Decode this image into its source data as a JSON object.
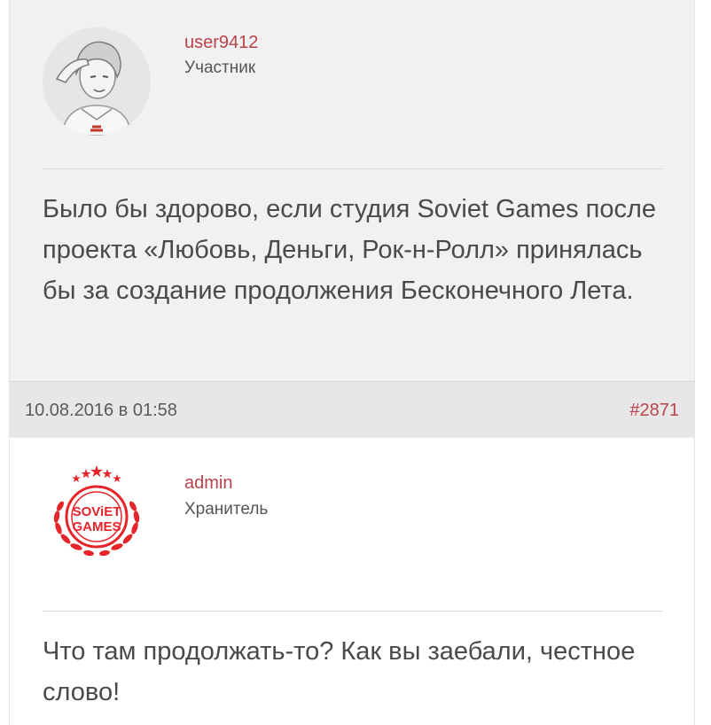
{
  "posts": [
    {
      "username": "user9412",
      "role": "Участник",
      "avatar_icon": "user-avatar-photo",
      "text": "Было бы здорово, если студия Soviet Games после проекта «Любовь, Деньги, Рок-н-Ролл» принялась бы за создание продолжения Бесконечного Лета.",
      "date": "10.08.2016 в 01:58",
      "number": "#2871"
    },
    {
      "username": "admin",
      "role": "Хранитель",
      "avatar_icon": "soviet-games-logo",
      "avatar_logo_text": [
        "SOViET",
        "GAMES"
      ],
      "text": "Что там продолжать-то? Как вы заебали, честное слово!"
    }
  ],
  "colors": {
    "accent": "#b9434a",
    "logo_red": "#e5252a",
    "post_bg": "#f1f1f1",
    "meta_bg": "#e7e7e7"
  }
}
